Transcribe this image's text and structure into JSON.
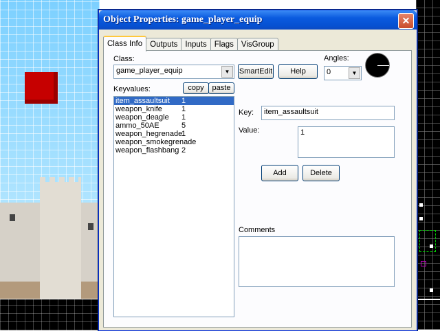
{
  "window": {
    "title": "Object Properties: game_player_equip",
    "close_glyph": "✕"
  },
  "tabs": [
    {
      "label": "Class Info",
      "active": true
    },
    {
      "label": "Outputs"
    },
    {
      "label": "Inputs"
    },
    {
      "label": "Flags"
    },
    {
      "label": "VisGroup"
    }
  ],
  "class_info": {
    "class_label": "Class:",
    "class_value": "game_player_equip",
    "smartedit_label": "SmartEdit",
    "help_label": "Help",
    "angles_label": "Angles:",
    "angles_value": "0",
    "keyvalues_label": "Keyvalues:",
    "copy_label": "copy",
    "paste_label": "paste",
    "keyvalues": [
      {
        "key": "item_assaultsuit",
        "value": "1",
        "selected": true
      },
      {
        "key": "weapon_knife",
        "value": "1"
      },
      {
        "key": "weapon_deagle",
        "value": "1"
      },
      {
        "key": "ammo_50AE",
        "value": "5"
      },
      {
        "key": "weapon_hegrenade",
        "value": "1"
      },
      {
        "key": "weapon_smokegrenade",
        "value": ""
      },
      {
        "key": "weapon_flashbang",
        "value": "2"
      }
    ],
    "key_label": "Key:",
    "key_value": "item_assaultsuit",
    "value_label": "Value:",
    "value_value": "1",
    "add_label": "Add",
    "delete_label": "Delete",
    "comments_label": "Comments",
    "comments_value": ""
  },
  "colors": {
    "titlebar": "#0a5adf",
    "selection": "#316ac5",
    "panel_bg": "#ece9d8"
  }
}
